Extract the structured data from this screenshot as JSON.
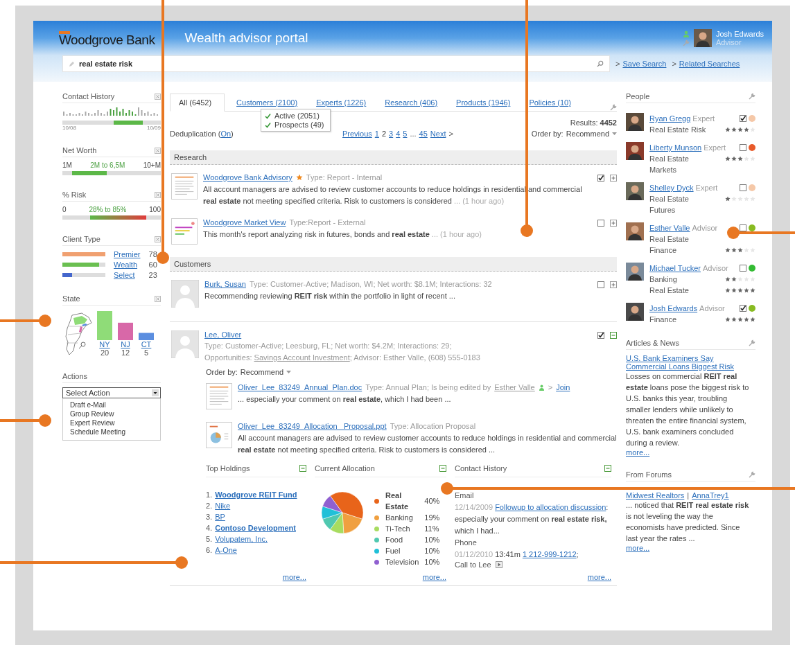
{
  "header": {
    "logo": "Woodgrove Bank",
    "title": "Wealth advisor portal",
    "user_name": "Josh Edwards",
    "user_role": "Advisor"
  },
  "search": {
    "value": "real estate risk",
    "links": [
      {
        "arrow": ">",
        "label": "Save Search"
      },
      {
        "arrow": ">",
        "label": "Related Searches"
      }
    ]
  },
  "contact_history": {
    "title": "Contact History",
    "start": "10/08",
    "end": "10/09"
  },
  "net_worth": {
    "title": "Net Worth",
    "min": "1M",
    "range": "2M to 6,5M",
    "max": "10+M"
  },
  "risk": {
    "title": "% Risk",
    "min": "0",
    "range": "28% to 85%",
    "max": "100"
  },
  "client_type": {
    "title": "Client Type",
    "items": [
      {
        "label": "Premier",
        "count": "78",
        "level": 1,
        "color": "#f0a070"
      },
      {
        "label": "Wealth",
        "count": "60",
        "level": 0.86,
        "color": "#6abf50"
      },
      {
        "label": "Select",
        "count": "23",
        "level": 0.22,
        "color": "#4466cc"
      }
    ]
  },
  "state": {
    "title": "State",
    "bars": [
      {
        "color": "#8fdc78"
      },
      {
        "color": "#d868a8"
      },
      {
        "color": "#5b8ee0"
      }
    ],
    "chart_data": {
      "type": "bar",
      "categories": [
        "NY",
        "NJ",
        "CT"
      ],
      "values": [
        20,
        12,
        5
      ],
      "data_labels": true
    }
  },
  "actions": {
    "title": "Actions",
    "select": "Select Action",
    "options": [
      "Draft e-Mail",
      "Group Review",
      "Expert Review",
      "Schedule Meeting"
    ]
  },
  "tabs": [
    {
      "label": "All (6452)",
      "selected": true
    },
    {
      "label": "Customers (2100)",
      "selected": false
    },
    {
      "label": "Experts (1226)",
      "selected": false
    },
    {
      "label": "Research (406)",
      "selected": false
    },
    {
      "label": "Products (1946)",
      "selected": false
    },
    {
      "label": "Policies (10)",
      "selected": false
    }
  ],
  "tab_menu": [
    {
      "label": "Active (2051)",
      "checked": true
    },
    {
      "label": "Prospects (49)",
      "checked": true
    }
  ],
  "deduplication": {
    "prefix": "Deduplication (",
    "link": "On",
    "suffix": ")"
  },
  "pagination": {
    "previous": "Previous",
    "pages": [
      {
        "label": "1",
        "selected": false
      },
      {
        "label": "2",
        "selected": true
      },
      {
        "label": "3",
        "selected": false
      },
      {
        "label": "4",
        "selected": false
      },
      {
        "label": "5",
        "selected": false
      }
    ],
    "ellipsis": "...",
    "last": "45",
    "next": "Next",
    "next_arrow": ">"
  },
  "results": {
    "label": "Results:",
    "count": "4452"
  },
  "order_by": {
    "label": "Order by:",
    "value": "Recommend"
  },
  "sections": [
    {
      "title": "Research",
      "items": [
        {
          "kind": "text-document",
          "title": "Woodgrove Bank Advisory",
          "starred": true,
          "meta": "Type: Report - Internal",
          "text": "All account managers are advised to review customer accounts to reduce holdings in residential and commercial **real estate** not meeting specified criteria. Risk to customers is considered",
          "time": "... (1 hour ago)",
          "checked": true,
          "expanded": false
        },
        {
          "kind": "chart-document",
          "title": "Woodgrove Market View",
          "starred": false,
          "meta": "Type:Report - External",
          "text": "This month's report analyzing risk in futures, bonds and **real estate**",
          "time": "... (1 hour ago)",
          "checked": false,
          "expanded": false
        }
      ]
    },
    {
      "title": "Customers",
      "items": [
        {
          "kind": "person",
          "title": "Burk, Susan",
          "starred": false,
          "meta": "Type: Customer-Active; Madison, WI; Net worth: $8.1M; Interactions: 32",
          "text": "Recommending reviewing **REIT risk** within the portfolio in light of recent ...",
          "checked": false,
          "expanded": false
        }
      ]
    }
  ],
  "customer_detail": {
    "name": "Lee, Oliver",
    "checked": true,
    "expanded": true,
    "meta": "Type: Customer-Active; Leesburg, FL; Net worth: $4.2M; Interactions: 29;",
    "opportunities_label": "Opportunities:",
    "opportunity": "Savings Account Investment",
    "advisor": "; Advisor: Esther Valle, (608) 555-0183",
    "order_by": {
      "label": "Order by:",
      "value": "Recommend"
    },
    "files": [
      {
        "kind": "text-document",
        "name": "Oliver_Lee_83249_Annual_Plan.doc",
        "meta": "Type: Annual Plan; Is being edited by",
        "editor": "Esther Valle",
        "join_arrow": ">",
        "join": "Join",
        "text": "... especially your comment on **real estate**, which I had been ..."
      },
      {
        "kind": "slides-document",
        "name": "Oliver_Lee_83249_Allocation _Proposal.ppt",
        "meta": "Type: Allocation Proposal",
        "text": "All account managers are advised to review customer accounts to reduce holdings in residential and commercial **real estate** not meeting specified criteria. Risk to customers is considered ..."
      }
    ],
    "holdings": {
      "title": "Top Holdings",
      "items": [
        {
          "rank": "1.",
          "name": "Woodgrove REIT Fund",
          "bold": true
        },
        {
          "rank": "2.",
          "name": "Nike",
          "bold": false
        },
        {
          "rank": "3.",
          "name": "BP",
          "bold": false
        },
        {
          "rank": "4.",
          "name": "Contoso Development",
          "bold": true
        },
        {
          "rank": "5.",
          "name": "Volupatem, Inc.",
          "bold": false
        },
        {
          "rank": "6.",
          "name": "A-One",
          "bold": false
        }
      ],
      "more": "more..."
    },
    "allocation": {
      "title": "Current Allocation",
      "slices": [
        {
          "color": "#e8641a"
        },
        {
          "color": "#f0a040"
        },
        {
          "color": "#a8dc60"
        },
        {
          "color": "#50c8b0"
        },
        {
          "color": "#20c0d8"
        },
        {
          "color": "#9060d0"
        }
      ],
      "chart_data": {
        "type": "pie",
        "categories": [
          "Real Estate",
          "Banking",
          "Ti-Tech",
          "Food",
          "Fuel",
          "Television"
        ],
        "values": [
          40,
          19,
          11,
          10,
          10,
          10
        ],
        "value_labels": [
          "40%",
          "19%",
          "11%",
          "10%",
          "10%",
          "10%"
        ]
      },
      "more": "more..."
    },
    "contacts": {
      "title": "Contact History",
      "entries": [
        {
          "type": "Email",
          "date": "12/14/2009",
          "link": "Followup to allocation discussion",
          "text": ": especially your comment on **real estate risk,** which I had..."
        },
        {
          "type": "Phone",
          "date": "01/12/2010",
          "time": "13:41m",
          "link": "1 212-999-1212",
          "text": ";",
          "note": "Call to Lee"
        }
      ],
      "more": "more..."
    }
  },
  "people": {
    "title": "People",
    "items": [
      {
        "name": "Ryan Gregg",
        "role": "Expert",
        "checked": true,
        "color": "#f5c8a8",
        "topics": [
          {
            "label": "Real Estate Risk",
            "stars": 4
          }
        ]
      },
      {
        "name": "Liberty Munson",
        "role": "Expert",
        "checked": false,
        "color": "#e85a2a",
        "topics": [
          {
            "label": "Real Estate Markets",
            "stars": 3
          }
        ]
      },
      {
        "name": "Shelley Dyck",
        "role": "Expert",
        "checked": false,
        "color": "#f5c8a8",
        "topics": [
          {
            "label": "Real Estate Futures",
            "stars": 1
          }
        ]
      },
      {
        "name": "Esther Valle",
        "role": "Advisor",
        "checked": false,
        "color": "#88bb22",
        "topics": [
          {
            "label": "Real Estate"
          },
          {
            "label": "Finance",
            "stars": 3
          }
        ]
      },
      {
        "name": "Michael Tucker",
        "role": "Advisor",
        "checked": false,
        "color": "#33bb33",
        "topics": [
          {
            "label": "Banking",
            "stars": 2
          },
          {
            "label": "Real Estate",
            "stars": 5
          }
        ]
      },
      {
        "name": "Josh Edwards",
        "role": "Advisor",
        "checked": true,
        "color": "#88bb22",
        "topics": [
          {
            "label": "Finance",
            "stars": 5
          }
        ]
      }
    ]
  },
  "articles": {
    "title": "Articles & News",
    "link": "U.S. Bank Examiners Say Commercial Loans Biggest Risk",
    "text": "Losses on commercial **REIT real estate** loans pose the biggest risk to U.S. banks this year, troubling smaller lenders while unlikely to threaten the entire financial system, U.S. bank examiners concluded during a review.",
    "more": "more..."
  },
  "forums": {
    "title": "From Forums",
    "links": [
      "Midwest Realtors",
      "AnnaTrey1"
    ],
    "separator": "|",
    "text": "... noticed that **REIT real estate risk** is not leveling the way the economists have predicted. Since last year the rates ...",
    "more": "more..."
  }
}
